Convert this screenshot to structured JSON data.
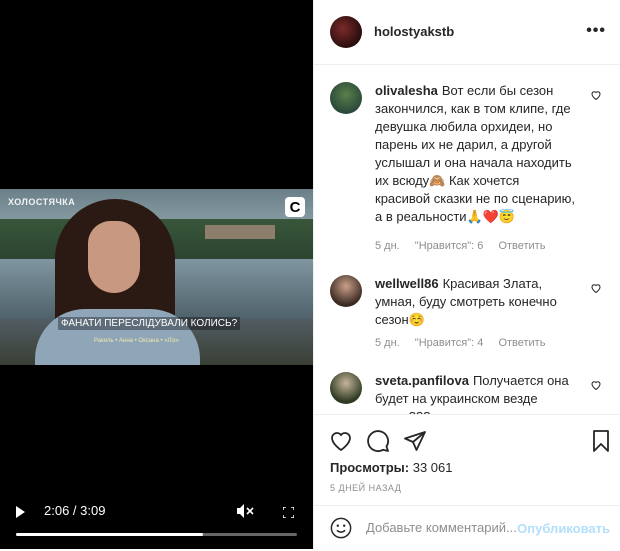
{
  "video": {
    "show_logo": "ХОЛОСТЯЧКА",
    "channel_badge": "C",
    "subtitle": "ФАНАТИ ПЕРЕСЛІДУВАЛИ КОЛИСЬ?",
    "name_caption": "Ракель • Анна • Оксана • «Ліз»",
    "time": "2:06 / 3:09",
    "progress": 0.666
  },
  "header": {
    "username": "holostyakstb",
    "more_icon": "more-dots-icon"
  },
  "comments": [
    {
      "username": "olivalesha",
      "text": "Вот если бы сезон закончился, как в том клипе, где девушка любила орхидеи, но парень их не дарил, а другой услышал и она начала находить их всюду🙈 Как хочется красивой сказки не по сценарию, а в реальности🙏❤️😇",
      "age": "5 дн.",
      "likes": "\"Нравится\": 6",
      "reply": "Ответить"
    },
    {
      "username": "wellwell86",
      "text": "Красивая Злата, умная, буду смотреть конечно сезон☺️",
      "age": "5 дн.",
      "likes": "\"Нравится\": 4",
      "reply": "Ответить"
    },
    {
      "username": "sveta.panfilova",
      "text": "Получается она будет на украинском везде сезон???",
      "age": "",
      "likes": "",
      "reply": ""
    }
  ],
  "actions": {
    "views_label": "Просмотры:",
    "views_count": "33 061",
    "date": "5 ДНЕЙ НАЗАД"
  },
  "add_comment": {
    "placeholder": "Добавьте комментарий...",
    "publish": "Опубликовать"
  },
  "colors": {
    "accent": "#0095f6",
    "publish_disabled": "#b2dffc",
    "muted": "#8e8e8e"
  }
}
